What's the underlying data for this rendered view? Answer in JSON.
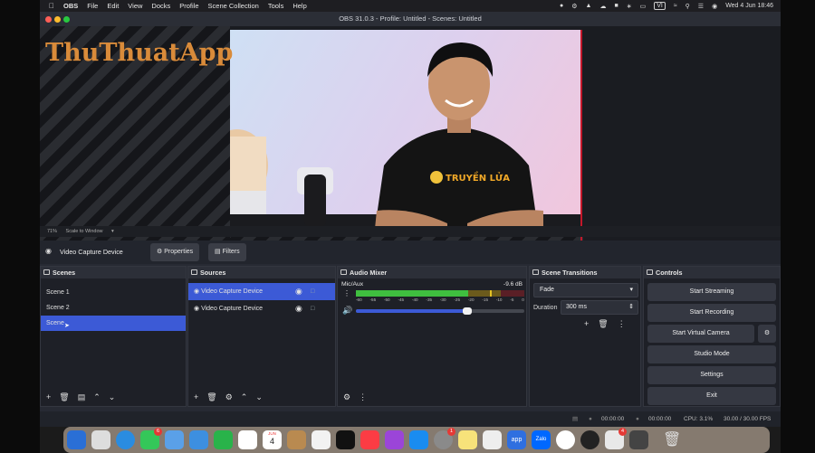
{
  "menubar": {
    "app_name": "OBS",
    "items": [
      "File",
      "Edit",
      "View",
      "Docks",
      "Profile",
      "Scene Collection",
      "Tools",
      "Help"
    ],
    "datetime": "Wed 4 Jun  18:46",
    "vi_badge": "VI"
  },
  "window": {
    "title": "OBS 31.0.3 - Profile: Untitled - Scenes: Untitled"
  },
  "preview": {
    "watermark": "ThuThuatApp",
    "zoom": "71%",
    "scale_mode": "Scale to Window",
    "shirt_text": "TRUYỀN LỬA"
  },
  "source_toolbar": {
    "source_name": "Video Capture Device",
    "properties_label": "Properties",
    "filters_label": "Filters"
  },
  "scenes": {
    "title": "Scenes",
    "items": [
      "Scene 1",
      "Scene 2",
      "Scene"
    ]
  },
  "sources": {
    "title": "Sources",
    "items": [
      "Video Capture Device",
      "Video Capture Device"
    ]
  },
  "mixer": {
    "title": "Audio Mixer",
    "channel": "Mic/Aux",
    "level": "-9.6 dB",
    "ticks": [
      "-60",
      "-55",
      "-50",
      "-45",
      "-40",
      "-35",
      "-30",
      "-25",
      "-20",
      "-15",
      "-10",
      "-5",
      "0"
    ],
    "volume_fraction": 0.66
  },
  "transitions": {
    "title": "Scene Transitions",
    "selected": "Fade",
    "duration_label": "Duration",
    "duration_value": "300 ms"
  },
  "controls": {
    "title": "Controls",
    "start_streaming": "Start Streaming",
    "start_recording": "Start Recording",
    "start_virtual_camera": "Start Virtual Camera",
    "studio_mode": "Studio Mode",
    "settings": "Settings",
    "exit": "Exit"
  },
  "status": {
    "stream_time": "00:00:00",
    "record_time": "00:00:00",
    "cpu": "CPU: 3.1%",
    "fps": "30.00 / 30.00 FPS"
  },
  "dock": {
    "calendar_month": "JUN",
    "calendar_day": "4",
    "zalo_label": "Zalo",
    "app_label": "app",
    "badge_messages": "6",
    "badge_settings": "1",
    "badge_other": "4"
  },
  "colors": {
    "accent_selected": "#3c5ad6",
    "meter_green": "#3fbf3f",
    "meter_yellow": "#c8a21a",
    "meter_red": "#c0323c",
    "preview_border": "#c3172a"
  }
}
